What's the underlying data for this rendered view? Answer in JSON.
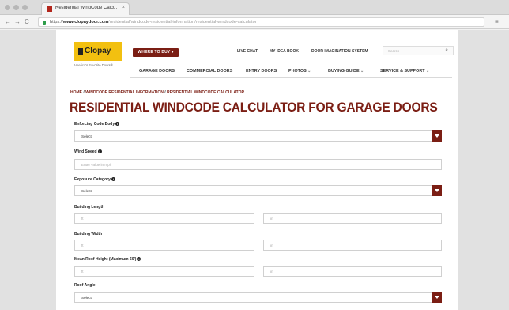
{
  "browser": {
    "tab_title": "Residential WindCode Calcu…",
    "tab_close": "×",
    "back": "←",
    "forward": "→",
    "reload": "C",
    "url_prefix": "https://",
    "url_host": "www.clopaydoor.com",
    "url_path": "/residential/windcode-residential-information/residential-windcode-calculator",
    "menu": "≡"
  },
  "site": {
    "logo_text": "Clopay",
    "tagline": "America's Favorite Doors®",
    "where_to_buy": "WHERE TO BUY ▾",
    "utility": {
      "live_chat": "LIVE CHAT",
      "my_idea_book": "MY IDEA BOOK",
      "door_imagination": "DOOR IMAGINATION SYSTEM",
      "search_placeholder": "Search",
      "search_icon": "⌕"
    },
    "nav": {
      "garage_doors": "GARAGE DOORS",
      "commercial_doors": "COMMERCIAL DOORS",
      "entry_doors": "ENTRY DOORS",
      "photos": "PHOTOS",
      "buying_guide": "BUYING GUIDE",
      "service_support": "SERVICE & SUPPORT",
      "caret": "⌄"
    }
  },
  "breadcrumb": {
    "home": "HOME",
    "sep": "/",
    "info": "WINDCODE RESIDENTIAL INFORMATION",
    "calc": "RESIDENTIAL WINDCODE CALCULATOR"
  },
  "page_title": "RESIDENTIAL WINDCODE CALCULATOR FOR GARAGE DOORS",
  "form": {
    "info_glyph": "i",
    "code_body_label": "Enforcing Code Body",
    "code_body_value": "Select",
    "wind_speed_label": "Wind Speed",
    "wind_speed_placeholder": "Enter value in mph",
    "exposure_label": "Exposure Category",
    "exposure_value": "Select",
    "length_label": "Building Length",
    "length_ft_placeholder": "ft",
    "length_in_placeholder": "in",
    "width_label": "Building Width",
    "width_ft_placeholder": "ft",
    "width_in_placeholder": "in",
    "roof_height_label": "Mean Roof Height (Maximum 60')",
    "roof_height_ft_placeholder": "ft",
    "roof_height_in_placeholder": "in",
    "roof_angle_label": "Roof Angle",
    "roof_angle_value": "Select"
  },
  "colors": {
    "brand": "#7b1e14",
    "logo_yellow": "#f2c010"
  }
}
